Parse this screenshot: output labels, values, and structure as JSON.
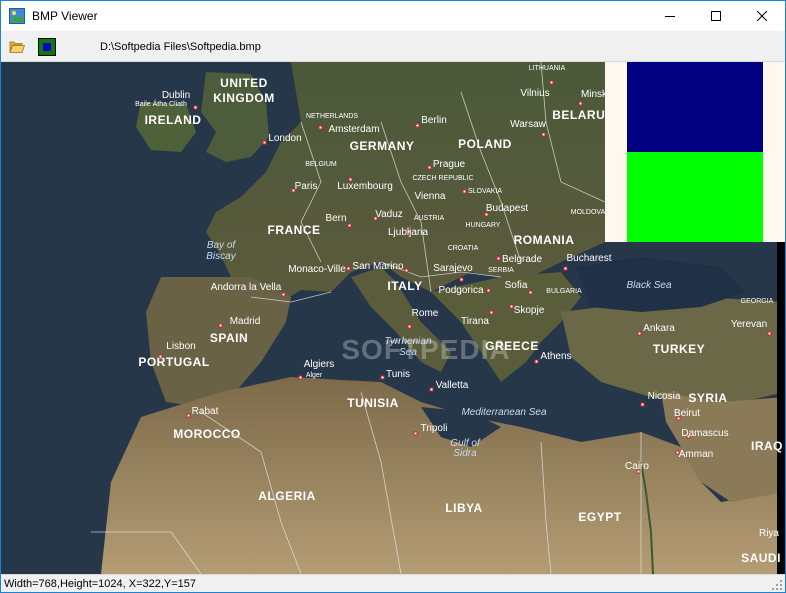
{
  "window": {
    "title": "BMP Viewer"
  },
  "toolbar": {
    "file_path": "D:\\Softpedia Files\\Softpedia.bmp"
  },
  "status": {
    "text": "Width=768,Height=1024, X=322,Y=157"
  },
  "map": {
    "watermark": "SOFTPEDIA",
    "countries": {
      "uk": "UNITED KINGDOM",
      "ireland": "IRELAND",
      "germany": "GERMANY",
      "poland": "POLAND",
      "belarus": "BELARUS",
      "lithuania": "LITHUANIA",
      "netherlands": "NETHERLANDS",
      "belgium": "BELGIUM",
      "czech": "CZECH REPUBLIC",
      "slovakia": "SLOVAKIA",
      "austria": "AUSTRIA",
      "hungary": "HUNGARY",
      "moldova": "MOLDOVA",
      "france": "FRANCE",
      "croatia": "CROATIA",
      "serbia": "SERBIA",
      "romania": "ROMANIA",
      "bulgaria": "BULGARIA",
      "italy": "ITALY",
      "spain": "SPAIN",
      "portugal": "PORTUGAL",
      "greece": "GREECE",
      "turkey": "TURKEY",
      "georgia": "GEORGIA",
      "syria": "SYRIA",
      "iraq": "IRAQ",
      "tunisia": "TUNISIA",
      "morocco": "MOROCCO",
      "algeria": "ALGERIA",
      "libya": "LIBYA",
      "egypt": "EGYPT",
      "saudi": "SAUDI"
    },
    "cities": {
      "dublin": "Dublin",
      "baile": "Baile Átha Cliath",
      "london": "London",
      "amsterdam": "Amsterdam",
      "berlin": "Berlin",
      "warsaw": "Warsaw",
      "vilnius": "Vilnius",
      "minsk": "Minsk",
      "paris": "Paris",
      "luxembourg": "Luxembourg",
      "prague": "Prague",
      "vienna": "Vienna",
      "budapest": "Budapest",
      "bern": "Bern",
      "vaduz": "Vaduz",
      "ljubljana": "Ljubljana",
      "monaco": "Monaco-Ville",
      "sanmarino": "San Marino",
      "sarajevo": "Sarajevo",
      "belgrade": "Belgrade",
      "bucharest": "Bucharest",
      "andorra": "Andorra la Vella",
      "madrid": "Madrid",
      "lisbon": "Lisbon",
      "rome": "Rome",
      "podgorica": "Podgorica",
      "sofia": "Sofia",
      "skopje": "Skopje",
      "tirana": "Tirana",
      "athens": "Athens",
      "ankara": "Ankara",
      "yerevan": "Yerevan",
      "algiers": "Algiers",
      "alger": "Alger",
      "tunis": "Tunis",
      "valletta": "Valletta",
      "rabat": "Rabat",
      "tripoli": "Tripoli",
      "nicosia": "Nicosia",
      "beirut": "Beirut",
      "damascus": "Damascus",
      "amman": "Amman",
      "cairo": "Cairo",
      "riya": "Riya"
    },
    "seas": {
      "biscay1": "Bay of",
      "biscay2": "Biscay",
      "tyrr1": "Tyrrhenian",
      "tyrr2": "Sea",
      "black": "Black Sea",
      "med": "Mediterranean Sea",
      "sidra1": "Gulf of",
      "sidra2": "Sidra"
    }
  },
  "colors": {
    "palette_blue": "#000080",
    "palette_green": "#00ff00",
    "palette_bg": "#fff8ee",
    "accent_border": "#1883d7"
  }
}
